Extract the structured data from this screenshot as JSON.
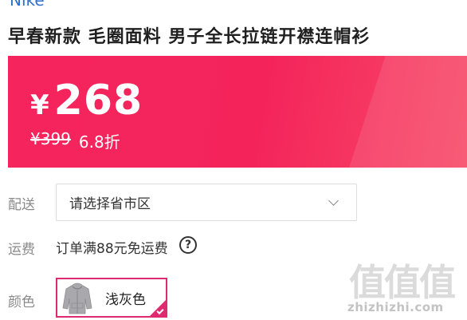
{
  "product": {
    "brand": "Nike",
    "title": "早春新款 毛圈面料 男子全长拉链开襟连帽衫"
  },
  "price": {
    "currency": "¥",
    "current": "268",
    "original": "¥399",
    "discount": "6.8折",
    "panel_color": "#f5245d"
  },
  "delivery": {
    "label": "配送",
    "select_value": "请选择省市区",
    "select_icon": "chevron-down-icon"
  },
  "shipping": {
    "label": "运费",
    "text": "订单满88元免运费",
    "help_icon": "question-circle-icon",
    "help_glyph": "?"
  },
  "color": {
    "label": "颜色",
    "selected_option": "浅灰色",
    "accent": "#e02a6f"
  },
  "watermark": {
    "glyphs": "值值值",
    "url": "zhizhizhi.com"
  }
}
